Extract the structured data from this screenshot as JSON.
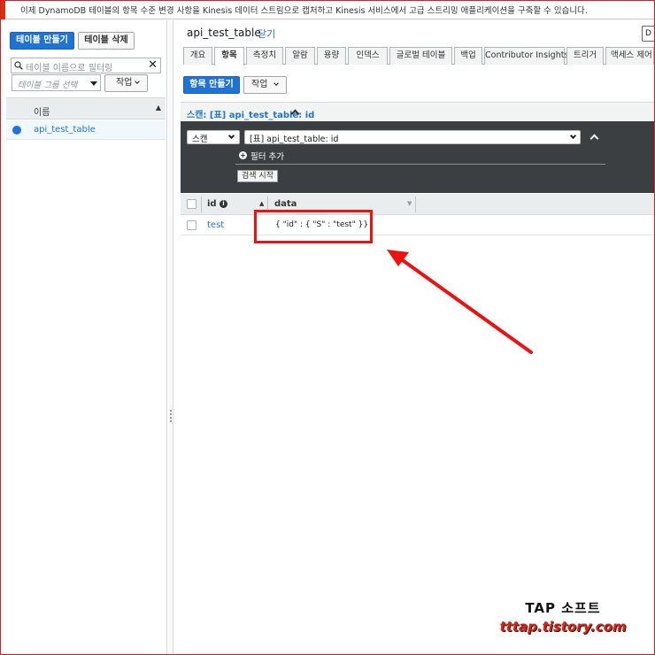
{
  "banner": {
    "message": "이제 DynamoDB 테이블의 항목 수준 변경 사항을 Kinesis 데이터 스트림으로 캡처하고 Kinesis 서비스에서 고급 스트리밍 애플리케이션을 구축할 수 있습니다."
  },
  "sidebar": {
    "create_table_label": "테이블 만들기",
    "delete_table_label": "테이블 삭제",
    "filter_placeholder": "테이블 이름으로 필터링",
    "table_group_placeholder": "테이블 그룹 선택",
    "actions_label": "작업",
    "column_name": "이름",
    "tables": [
      {
        "name": "api_test_table",
        "selected": true
      }
    ]
  },
  "main": {
    "table_name": "api_test_table",
    "close_label": "닫기",
    "tabs": [
      {
        "label": "개요"
      },
      {
        "label": "항목",
        "active": true
      },
      {
        "label": "측정치"
      },
      {
        "label": "알람"
      },
      {
        "label": "용량"
      },
      {
        "label": "인덱스"
      },
      {
        "label": "글로벌 테이블"
      },
      {
        "label": "백업"
      },
      {
        "label": "Contributor Insights"
      },
      {
        "label": "트리거"
      },
      {
        "label": "액세스 제어"
      }
    ],
    "create_item_label": "항목 만들기",
    "actions_label": "작업",
    "scan_header": "스캔: [표] api_test_table: id",
    "scan_mode": "스캔",
    "scan_target": "[표] api_test_table: id",
    "add_filter_label": "필터 추가",
    "start_search_label": "검색 시작",
    "columns": {
      "id": "id",
      "data": "data"
    },
    "rows": [
      {
        "id": "test",
        "data": "{ \"id\" : { \"S\" : \"test\" }}"
      }
    ]
  },
  "watermark": {
    "line1": "TAP 소프트",
    "line2": "tttap.tistory.com"
  },
  "colors": {
    "primary": "#1f74d3",
    "annotation_red": "#ee1111",
    "dark_panel": "#3c3f41"
  }
}
